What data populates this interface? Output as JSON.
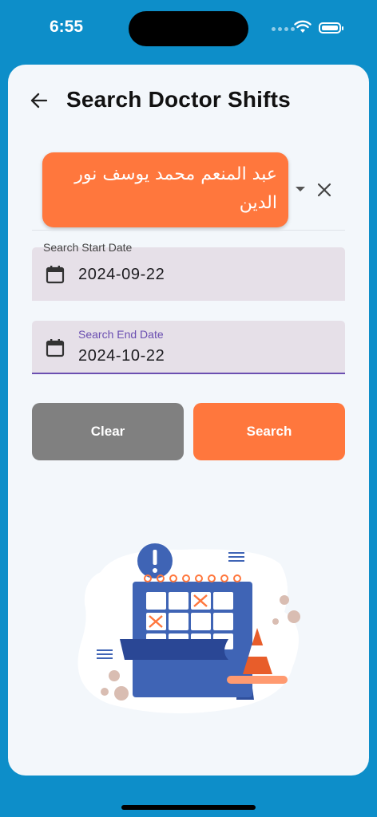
{
  "status_bar": {
    "time": "6:55"
  },
  "header": {
    "title": "Search Doctor Shifts",
    "back_icon": "arrow-left-icon"
  },
  "doctor_select": {
    "selected_value": "عبد المنعم محمد يوسف نور الدين"
  },
  "start_date": {
    "label": "Search Start Date",
    "value": "2024-09-22",
    "icon": "calendar-icon"
  },
  "end_date": {
    "label": "Search End Date",
    "value": "2024-10-22",
    "icon": "calendar-icon"
  },
  "buttons": {
    "clear": "Clear",
    "search": "Search"
  },
  "colors": {
    "background": "#0d8ec9",
    "card": "#f3f7fb",
    "accent": "#ff773d",
    "clear_button": "#808080",
    "focus": "#6b4fb1",
    "field_fill": "#e6e0e8"
  }
}
